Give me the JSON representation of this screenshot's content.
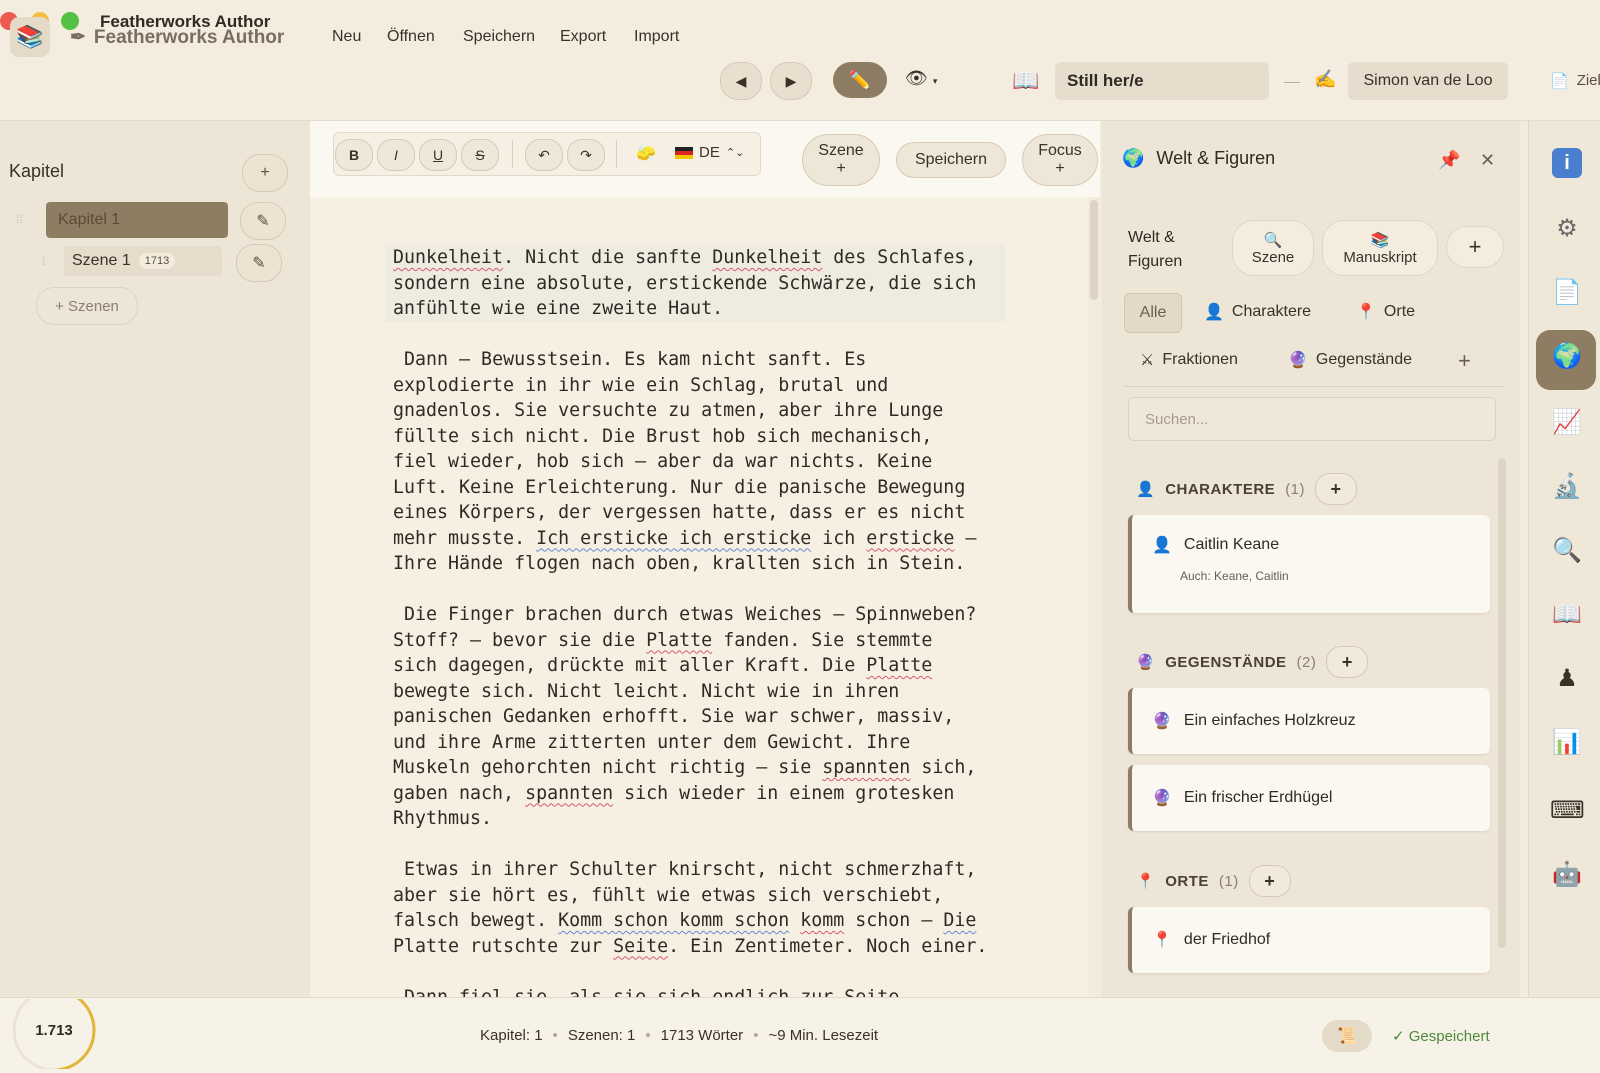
{
  "window": {
    "title": "Featherworks Author"
  },
  "toolbar": {
    "brand": "Featherworks Author",
    "menu": [
      "Neu",
      "Öffnen",
      "Speichern",
      "Export",
      "Import"
    ],
    "book_title": "Still her/e",
    "author": "Simon van de Loo",
    "goal_label": "Ziel"
  },
  "sidebar": {
    "heading": "Kapitel",
    "add_symbol": "+",
    "chapter_label": "Kapitel 1",
    "scene_label": "Szene 1",
    "scene_words": "1713",
    "add_scene": "+ Szenen"
  },
  "editor_toolbar": {
    "bold": "B",
    "italic": "I",
    "underline": "U",
    "strike": "S",
    "language": "DE",
    "scene_button": "Szene",
    "save_button": "Speichern",
    "focus_button": "Focus",
    "plus": "+"
  },
  "panel": {
    "title": "Welt & Figuren",
    "label_line1": "Welt &",
    "label_line2": "Figuren",
    "tabs": [
      "Szene",
      "Manuskript"
    ],
    "filters": {
      "all": "Alle",
      "characters": "Charaktere",
      "places": "Orte",
      "factions": "Fraktionen",
      "items": "Gegenstände"
    },
    "search_placeholder": "Suchen...",
    "sections": {
      "characters": {
        "title": "CHARAKTERE",
        "count": "(1)"
      },
      "items": {
        "title": "GEGENSTÄNDE",
        "count": "(2)"
      },
      "places": {
        "title": "ORTE",
        "count": "(1)"
      }
    },
    "character_name": "Caitlin Keane",
    "character_aliases": "Auch: Keane, Caitlin",
    "item_1": "Ein einfaches Holzkreuz",
    "item_2": "Ein frischer Erdhügel",
    "place_1": "der Friedhof"
  },
  "status": {
    "word_count": "1.713",
    "chapters": "Kapitel: 1",
    "scenes": "Szenen: 1",
    "words": "1713 Wörter",
    "reading_time": "~9 Min. Lesezeit",
    "saved": "✓ Gespeichert",
    "word_goal_progress": 0.48
  },
  "colors": {
    "accent": "#8e7d63",
    "spelling": "#d45a70",
    "grammar": "#6a8ad6",
    "saved": "#4c8a3a",
    "progress": "#e2b43a"
  },
  "icons": {
    "rail": [
      "info-icon",
      "gear-icon",
      "document-icon",
      "globe-icon",
      "chart-line-icon",
      "microscope-icon",
      "search-icon",
      "book-icon",
      "figure-icon",
      "bar-chart-icon",
      "keyboard-icon",
      "robot-icon"
    ]
  }
}
